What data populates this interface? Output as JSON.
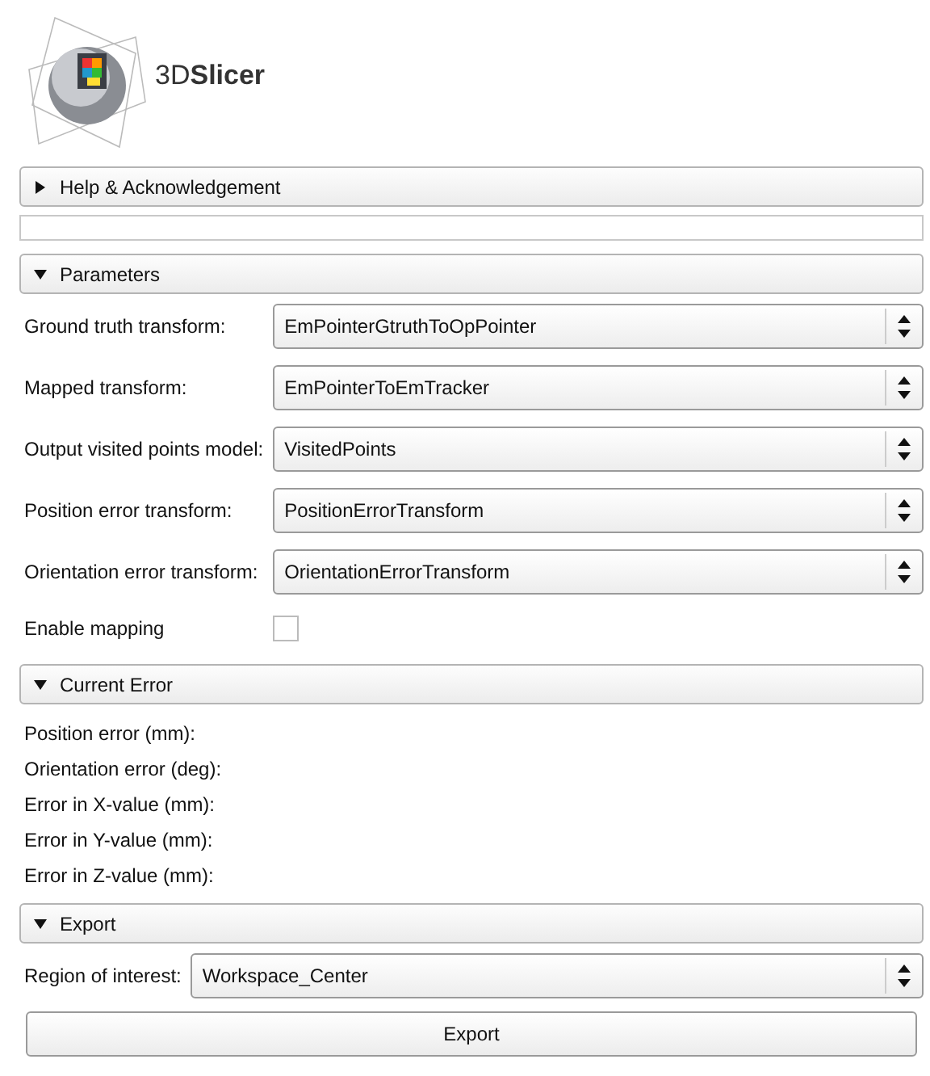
{
  "logo": {
    "text": "3D**Slicer**"
  },
  "sections": [
    {
      "title": "Help & Acknowledgement",
      "expanded": false
    },
    {
      "title": "Parameters",
      "expanded": true,
      "items": [
        {
          "kind": "combo",
          "label": "Ground truth transform:",
          "value": "EmPointerGtruthToOpPointer"
        },
        {
          "kind": "combo",
          "label": "Mapped transform:",
          "value": "EmPointerToEmTracker"
        },
        {
          "kind": "combo",
          "label": "Output visited points model:",
          "value": "VisitedPoints"
        },
        {
          "kind": "combo",
          "label": "Position error transform:",
          "value": "PositionErrorTransform"
        },
        {
          "kind": "combo",
          "label": "Orientation error transform:",
          "value": "OrientationErrorTransform"
        },
        {
          "kind": "checkbox",
          "label": "Enable mapping",
          "checked": false
        }
      ]
    },
    {
      "title": "Current Error",
      "expanded": true,
      "items": [
        {
          "kind": "readout",
          "label": "Position error (mm):"
        },
        {
          "kind": "readout",
          "label": "Orientation error (deg):"
        },
        {
          "kind": "readout",
          "label": "Error in X-value (mm):"
        },
        {
          "kind": "readout",
          "label": "Error in Y-value (mm):"
        },
        {
          "kind": "readout",
          "label": "Error in Z-value (mm):"
        }
      ]
    },
    {
      "title": "Export",
      "expanded": true,
      "items": [
        {
          "kind": "combo",
          "label": "Region of interest:",
          "value": "Workspace_Center"
        },
        {
          "kind": "button",
          "label": "Export"
        }
      ]
    }
  ]
}
